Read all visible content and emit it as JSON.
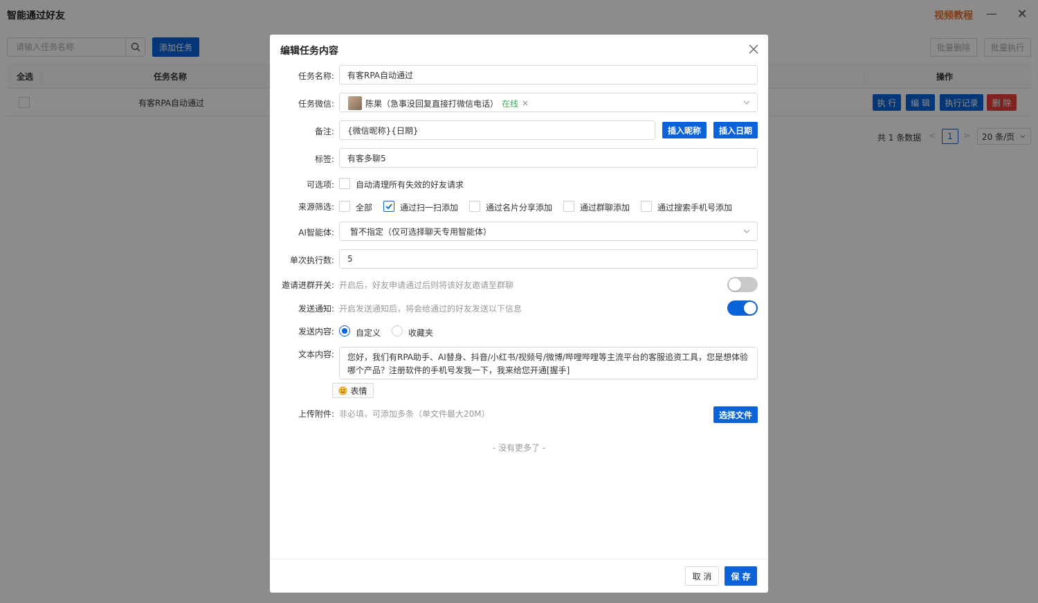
{
  "app": {
    "title": "智能通过好友",
    "video_tutorial": "视频教程",
    "window_min_glyph": "—",
    "window_close_glyph": "✕"
  },
  "toolbar": {
    "search_placeholder": "请输入任务名称",
    "add_task_label": "添加任务",
    "batch_delete_label": "批量删除",
    "batch_execute_label": "批量执行"
  },
  "table": {
    "headers": {
      "select_all": "全选",
      "task_name": "任务名称",
      "actions": "操作"
    },
    "rows": [
      {
        "task_name": "有客RPA自动通过",
        "actions": [
          "执 行",
          "编 辑",
          "执行记录",
          "删 除"
        ]
      }
    ]
  },
  "pagination": {
    "total_text": "共 1 条数据",
    "prev_glyph": "<",
    "current_page": "1",
    "next_glyph": ">",
    "page_size": "20 条/页"
  },
  "modal": {
    "title": "编辑任务内容",
    "fields": {
      "task_name": {
        "label": "任务名称:",
        "value": "有客RPA自动通过"
      },
      "task_wechat": {
        "label": "任务微信:",
        "account_name": "陈果（急事没回复直接打微信电话）",
        "status": "在线",
        "remove_glyph": "×"
      },
      "remark": {
        "label": "备注:",
        "value": "{微信昵称}{日期}",
        "insert_nickname": "插入昵称",
        "insert_date": "插入日期"
      },
      "tag": {
        "label": "标签:",
        "value": "有客多聊5"
      },
      "options": {
        "label": "可选项:",
        "auto_clean": {
          "text": "自动清理所有失效的好友请求",
          "checked": false
        }
      },
      "source_filter": {
        "label": "来源筛选:",
        "items": [
          {
            "text": "全部",
            "checked": false
          },
          {
            "text": "通过扫一扫添加",
            "checked": true
          },
          {
            "text": "通过名片分享添加",
            "checked": false
          },
          {
            "text": "通过群聊添加",
            "checked": false
          },
          {
            "text": "通过搜索手机号添加",
            "checked": false
          }
        ]
      },
      "ai_agent": {
        "label": "AI智能体:",
        "value": "暂不指定（仅可选择聊天专用智能体）"
      },
      "batch_count": {
        "label": "单次执行数:",
        "value": "5"
      },
      "invite_group": {
        "label": "邀请进群开关:",
        "hint": "开启后，好友申请通过后则将该好友邀请至群聊",
        "enabled": false
      },
      "send_notice": {
        "label": "发送通知:",
        "hint": "开启发送通知后，将会给通过的好友发送以下信息",
        "enabled": true
      },
      "send_content": {
        "label": "发送内容:",
        "options": [
          "自定义",
          "收藏夹"
        ],
        "selected": "自定义"
      },
      "text_content": {
        "label": "文本内容:",
        "value": "您好，我们有RPA助手、AI替身、抖音/小红书/视频号/微博/哔哩哔哩等主流平台的客服追资工具，您是想体验哪个产品？注册软件的手机号发我一下，我来给您开通[握手]",
        "emoji_button": "表情"
      },
      "attachment": {
        "label": "上传附件:",
        "hint": "非必填，可添加多条（单文件最大20M）",
        "choose_file": "选择文件"
      }
    },
    "no_more": "- 没有更多了 -",
    "footer": {
      "cancel": "取 消",
      "save": "保 存"
    }
  },
  "colors": {
    "primary": "#0a63d9",
    "danger": "#e8413c",
    "accent_orange": "#e8742f",
    "online_green": "#3daa5c",
    "toggle_off": "#c9c9c9"
  }
}
